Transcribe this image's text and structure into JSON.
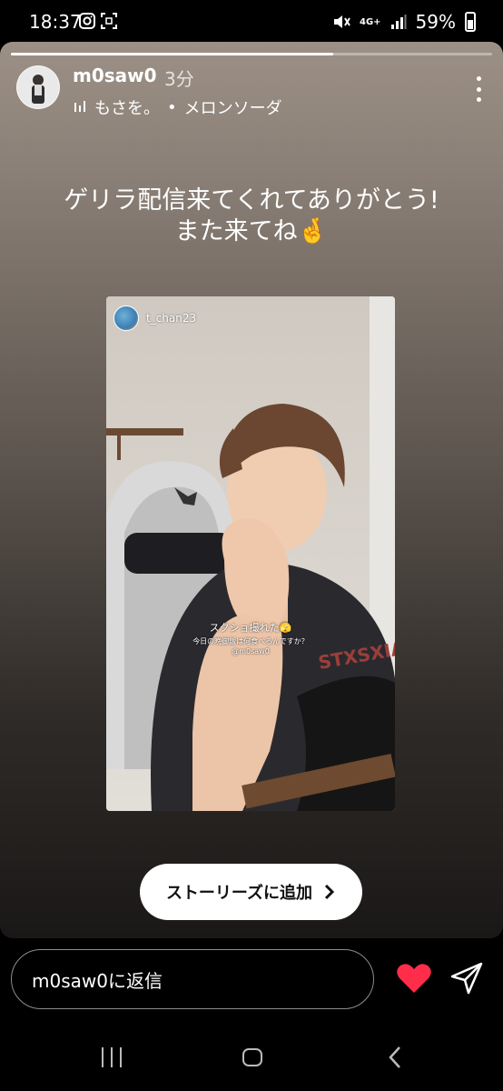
{
  "status_bar": {
    "time": "18:37",
    "battery": "59%",
    "network": "4G+"
  },
  "story": {
    "progress": 0.67,
    "username": "m0saw0",
    "time_ago": "3分",
    "music_artist": "もさを。",
    "music_separator": "•",
    "music_title": "メロンソーダ",
    "caption_line1": "ゲリラ配信来てくれてありがとう!",
    "caption_line2": "また来てね🤞",
    "shot": {
      "username": "t_chan23",
      "line1": "スクショ撮れた🫣",
      "line2": "今日の晩御飯は何食べるんですか？",
      "line3": "@m0saw0"
    },
    "add_to_story": "ストーリーズに追加"
  },
  "reply": {
    "placeholder": "m0saw0に返信"
  },
  "colors": {
    "heart": "#ff2d4a"
  }
}
